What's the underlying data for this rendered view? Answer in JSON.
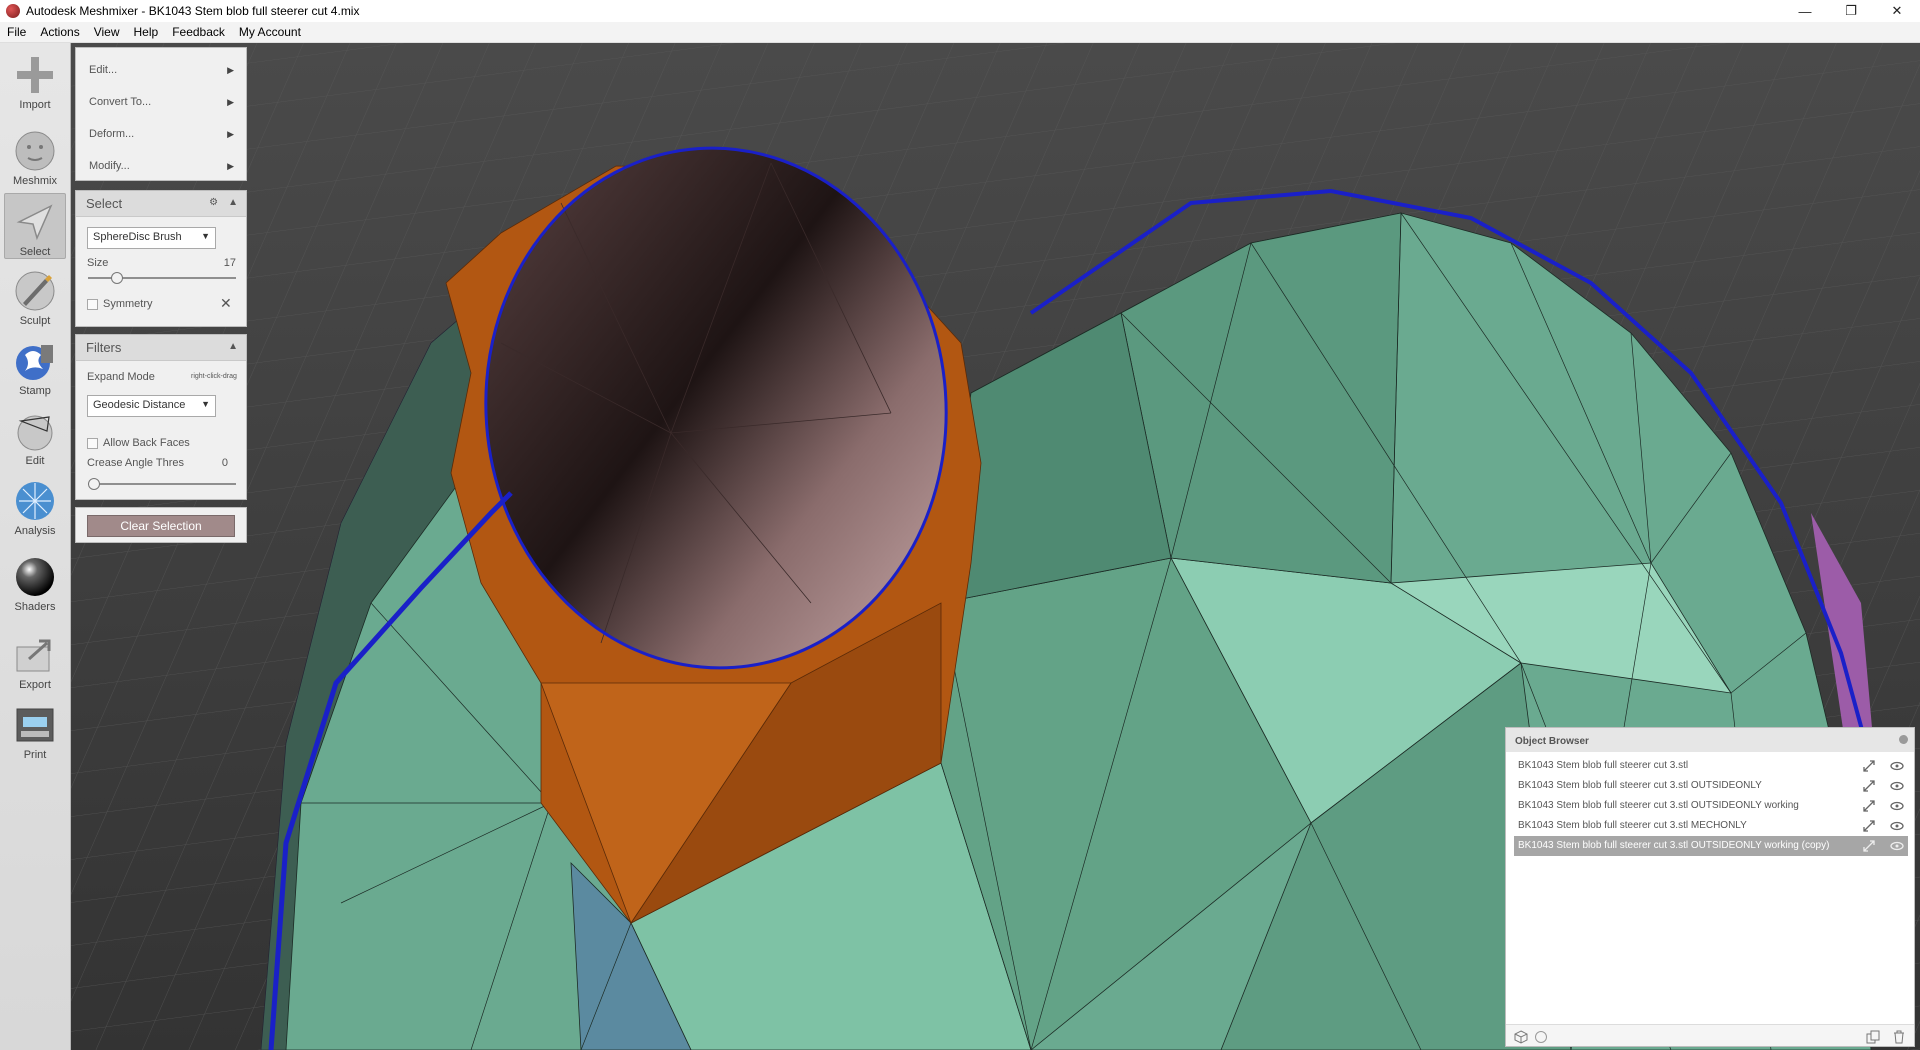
{
  "window": {
    "title": "Autodesk Meshmixer - BK1043 Stem blob full steerer cut 4.mix",
    "controls": {
      "minimize": "—",
      "maximize": "❐",
      "close": "✕"
    }
  },
  "menu": [
    "File",
    "Actions",
    "View",
    "Help",
    "Feedback",
    "My Account"
  ],
  "toolbar": [
    {
      "label": "Import",
      "icon": "plus-icon"
    },
    {
      "label": "Meshmix",
      "icon": "meshmix-face-icon"
    },
    {
      "label": "Select",
      "icon": "select-arrow-icon",
      "active": true
    },
    {
      "label": "Sculpt",
      "icon": "sculpt-brush-icon"
    },
    {
      "label": "Stamp",
      "icon": "stamp-icon"
    },
    {
      "label": "Edit",
      "icon": "edit-sphere-icon"
    },
    {
      "label": "Analysis",
      "icon": "analysis-icon"
    },
    {
      "label": "Shaders",
      "icon": "shader-sphere-icon"
    },
    {
      "label": "Export",
      "icon": "export-icon"
    },
    {
      "label": "Print",
      "icon": "print-icon"
    }
  ],
  "actions_menu": [
    "Edit...",
    "Convert To...",
    "Deform...",
    "Modify..."
  ],
  "select_panel": {
    "title": "Select",
    "brush": "SphereDisc Brush",
    "size_label": "Size",
    "size_value": "17",
    "size_fraction": 0.17,
    "symmetry_label": "Symmetry"
  },
  "filters_panel": {
    "title": "Filters",
    "expand_mode_label": "Expand Mode",
    "expand_hint": "right-click-drag",
    "expand_mode_value": "Geodesic Distance",
    "allow_back_faces_label": "Allow Back Faces",
    "crease_angle_label": "Crease Angle Thres",
    "crease_angle_value": "0",
    "crease_fraction": 0.0
  },
  "clear_button": "Clear Selection",
  "object_browser": {
    "title": "Object Browser",
    "items": [
      {
        "name": "BK1043 Stem blob full steerer cut 3.stl",
        "selected": false
      },
      {
        "name": "BK1043 Stem blob full steerer cut 3.stl OUTSIDEONLY",
        "selected": false
      },
      {
        "name": "BK1043 Stem blob full steerer cut 3.stl OUTSIDEONLY working",
        "selected": false
      },
      {
        "name": "BK1043 Stem blob full steerer cut 3.stl MECHONLY",
        "selected": false
      },
      {
        "name": "BK1043 Stem blob full steerer cut 3.stl OUTSIDEONLY working (copy)",
        "selected": true
      }
    ]
  },
  "colors": {
    "mesh_green": "#6fae95",
    "mesh_orange": "#b55a12",
    "selection_outline": "#1a20c8",
    "hole_interior": "#3a2626"
  }
}
